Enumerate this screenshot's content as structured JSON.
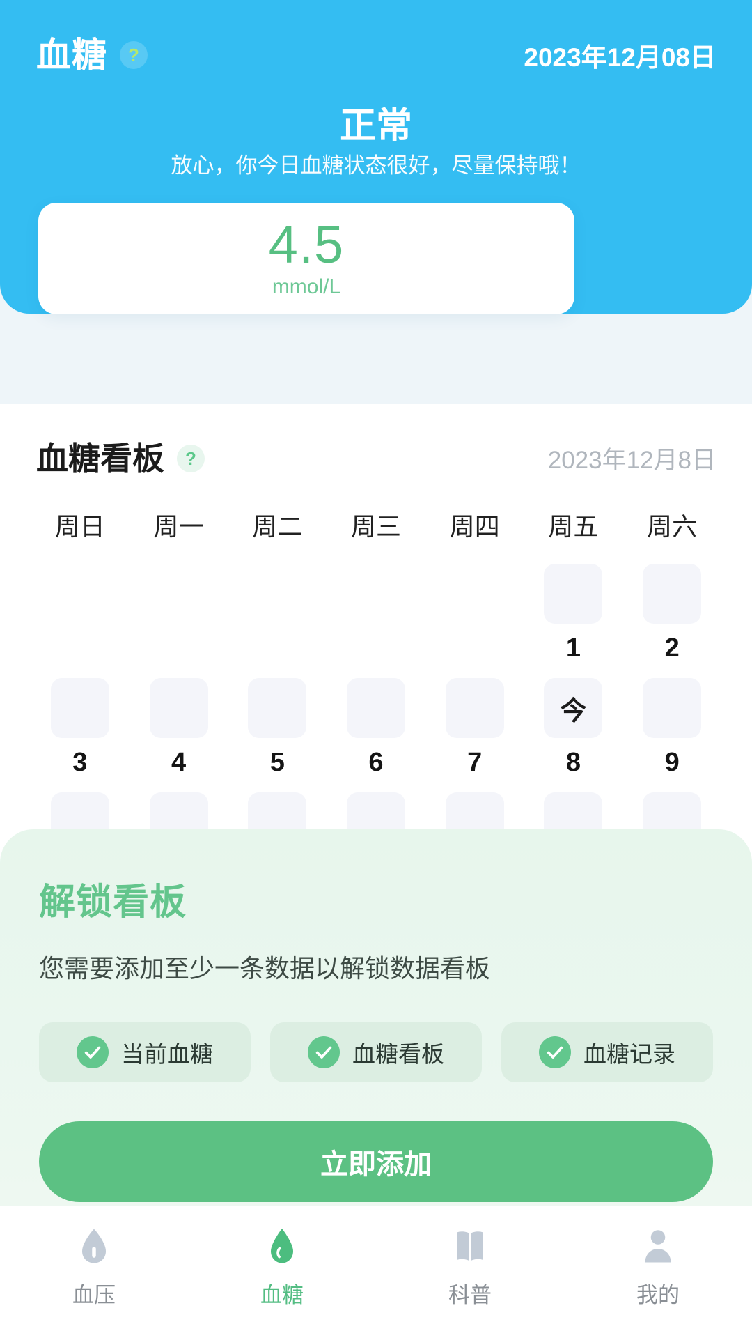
{
  "hero": {
    "title": "血糖",
    "help_icon": "question-mark-icon",
    "date": "2023年12月08日",
    "status": "正常",
    "status_desc": "放心，你今日血糖状态很好，尽量保持哦！",
    "value": "4.5",
    "unit": "mmol/L",
    "bg_color": "#34bdf2",
    "value_color": "#57bf82"
  },
  "board": {
    "title": "血糖看板",
    "help_icon": "question-mark-icon",
    "date": "2023年12月8日",
    "weekdays": [
      "周日",
      "周一",
      "周二",
      "周三",
      "周四",
      "周五",
      "周六"
    ],
    "rows": [
      [
        {
          "tile": "",
          "num": "",
          "blank": true
        },
        {
          "tile": "",
          "num": "",
          "blank": true
        },
        {
          "tile": "",
          "num": "",
          "blank": true
        },
        {
          "tile": "",
          "num": "",
          "blank": true
        },
        {
          "tile": "",
          "num": "",
          "blank": true
        },
        {
          "tile": "",
          "num": "1",
          "blank": false
        },
        {
          "tile": "",
          "num": "2",
          "blank": false
        }
      ],
      [
        {
          "tile": "",
          "num": "3",
          "blank": false
        },
        {
          "tile": "",
          "num": "4",
          "blank": false
        },
        {
          "tile": "",
          "num": "5",
          "blank": false
        },
        {
          "tile": "",
          "num": "6",
          "blank": false
        },
        {
          "tile": "",
          "num": "7",
          "blank": false
        },
        {
          "tile": "今",
          "num": "8",
          "blank": false
        },
        {
          "tile": "",
          "num": "9",
          "blank": false
        }
      ],
      [
        {
          "tile": "",
          "num": "",
          "blank": false
        },
        {
          "tile": "",
          "num": "",
          "blank": false
        },
        {
          "tile": "",
          "num": "",
          "blank": false
        },
        {
          "tile": "",
          "num": "",
          "blank": false
        },
        {
          "tile": "",
          "num": "",
          "blank": false
        },
        {
          "tile": "",
          "num": "",
          "blank": false
        },
        {
          "tile": "",
          "num": "",
          "blank": false
        }
      ]
    ]
  },
  "unlock": {
    "title": "解锁看板",
    "desc": "您需要添加至少一条数据以解锁数据看板",
    "accent_color": "#63c58c",
    "chips": [
      {
        "label": "当前血糖",
        "icon": "check-circle-icon"
      },
      {
        "label": "血糖看板",
        "icon": "check-circle-icon"
      },
      {
        "label": "血糖记录",
        "icon": "check-circle-icon"
      }
    ],
    "cta_label": "立即添加",
    "cta_color": "#5cc183"
  },
  "tabbar": {
    "items": [
      {
        "label": "血压",
        "icon": "blood-pressure-icon",
        "active": false
      },
      {
        "label": "血糖",
        "icon": "blood-glucose-drop-icon",
        "active": true
      },
      {
        "label": "科普",
        "icon": "book-icon",
        "active": false
      },
      {
        "label": "我的",
        "icon": "person-icon",
        "active": false
      }
    ],
    "active_color": "#54bd83",
    "inactive_color": "#c2cbd6"
  }
}
